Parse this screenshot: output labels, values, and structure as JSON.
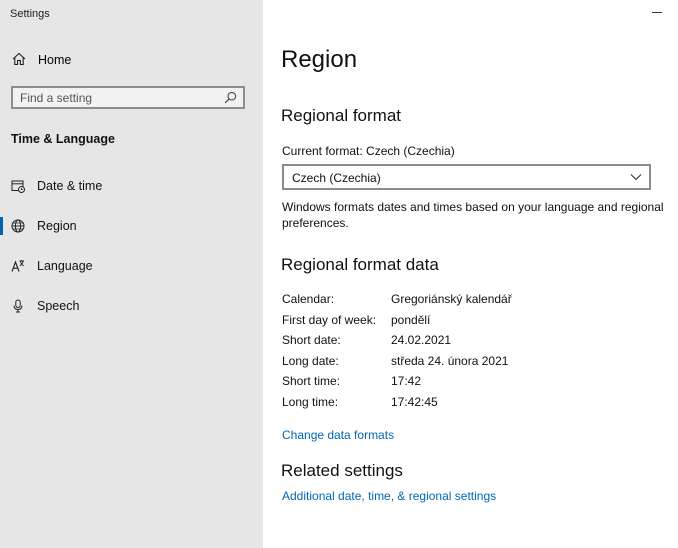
{
  "window": {
    "title": "Settings"
  },
  "sidebar": {
    "home_label": "Home",
    "search_placeholder": "Find a setting",
    "section_title": "Time & Language",
    "items": [
      {
        "label": "Date & time",
        "icon": "calendar-clock-icon",
        "selected": false
      },
      {
        "label": "Region",
        "icon": "globe-icon",
        "selected": true
      },
      {
        "label": "Language",
        "icon": "language-icon",
        "selected": false
      },
      {
        "label": "Speech",
        "icon": "microphone-icon",
        "selected": false
      }
    ]
  },
  "main": {
    "title": "Region",
    "regional_format": {
      "heading": "Regional format",
      "current_label": "Current format: Czech (Czechia)",
      "dropdown_value": "Czech (Czechia)",
      "description": "Windows formats dates and times based on your language and regional preferences."
    },
    "format_data": {
      "heading": "Regional format data",
      "rows": [
        {
          "key": "Calendar:",
          "value": "Gregoriánský kalendář"
        },
        {
          "key": "First day of week:",
          "value": "pondělí"
        },
        {
          "key": "Short date:",
          "value": "24.02.2021"
        },
        {
          "key": "Long date:",
          "value": "středa 24. února 2021"
        },
        {
          "key": "Short time:",
          "value": "17:42"
        },
        {
          "key": "Long time:",
          "value": "17:42:45"
        }
      ],
      "change_link": "Change data formats"
    },
    "related": {
      "heading": "Related settings",
      "link": "Additional date, time, & regional settings"
    }
  },
  "colors": {
    "accent": "#0063b1",
    "link": "#0067b8",
    "sidebar_bg": "#e6e6e6"
  }
}
